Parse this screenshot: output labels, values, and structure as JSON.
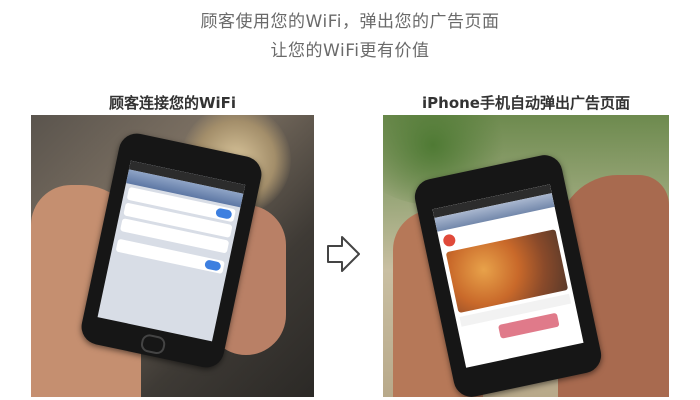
{
  "headline": {
    "line1": "顾客使用您的WiFi，弹出您的广告页面",
    "line2": "让您的WiFi更有价值"
  },
  "left_panel": {
    "caption": "顾客连接您的WiFi"
  },
  "right_panel": {
    "caption": "iPhone手机自动弹出广告页面"
  },
  "colors": {
    "caption_text": "#333333",
    "headline_text": "#6a6a6a",
    "arrow_stroke": "#444444"
  }
}
